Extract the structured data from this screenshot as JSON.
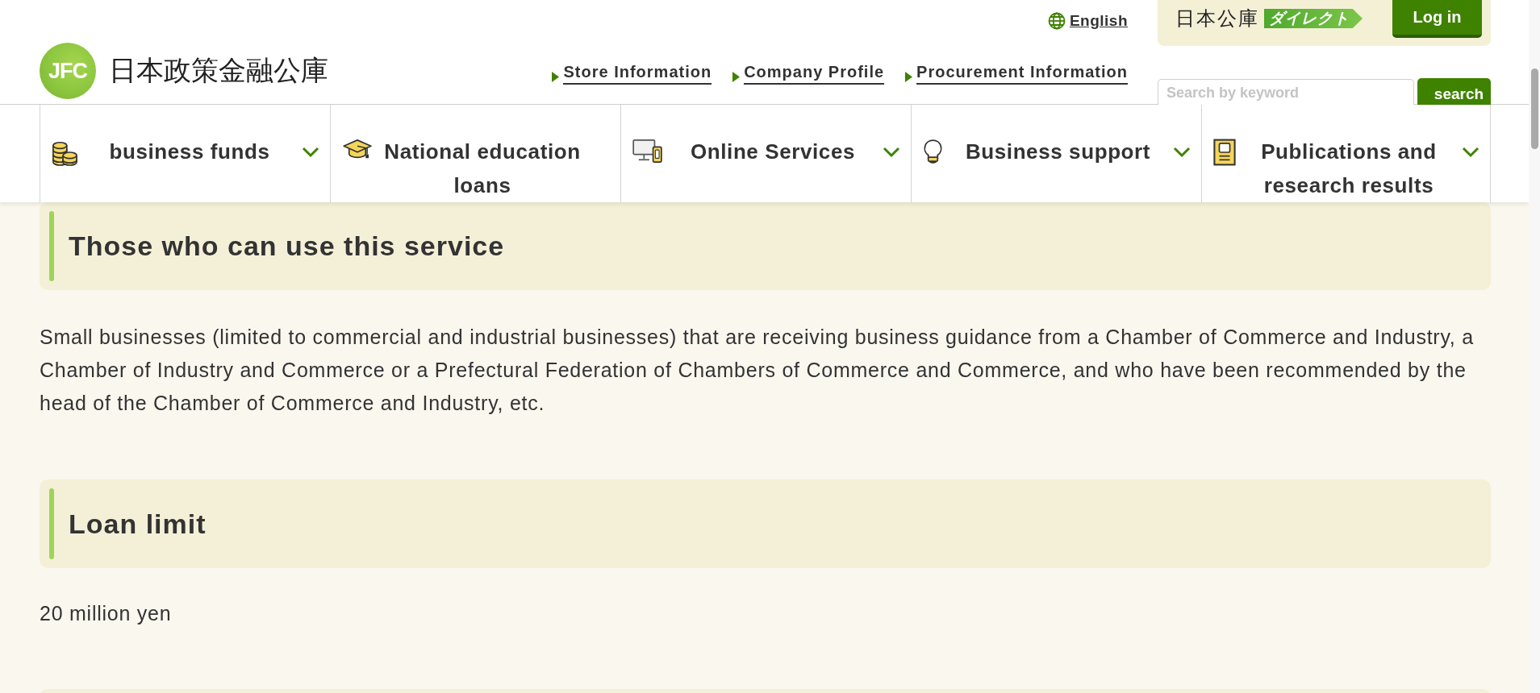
{
  "header": {
    "logo": {
      "mark": "JFC",
      "name": "日本政策金融公庫"
    },
    "language_link": "English",
    "utility_links": [
      "Store Information",
      "Company Profile",
      "Procurement Information"
    ],
    "login_panel": {
      "service_name": "日本公庫",
      "service_tag": "ダイレクト",
      "button": "Log in"
    },
    "search": {
      "placeholder": "Search by keyword",
      "button": "search"
    }
  },
  "nav": {
    "items": [
      {
        "label": "business funds",
        "dropdown": true
      },
      {
        "label": "National education loans",
        "dropdown": false
      },
      {
        "label": "Online Services",
        "dropdown": true
      },
      {
        "label": "Business support",
        "dropdown": true
      },
      {
        "label": "Publications and research results",
        "dropdown": true
      }
    ]
  },
  "sections": [
    {
      "heading": "Those who can use this service",
      "text": "Small businesses (limited to commercial and industrial businesses) that are receiving business guidance from a Chamber of Commerce and Industry, a Chamber of Industry and Commerce or a Prefectural Federation of Chambers of Commerce and Commerce, and who have been recommended by the head of the Chamber of Commerce and Industry, etc."
    },
    {
      "heading": "Loan limit",
      "text": "20 million yen"
    }
  ]
}
